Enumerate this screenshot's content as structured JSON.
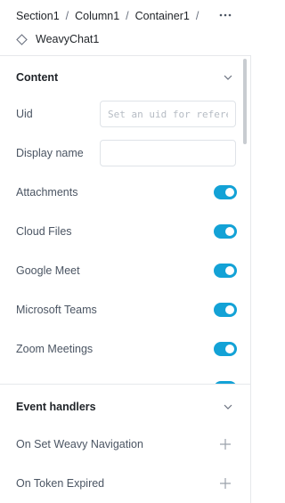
{
  "breadcrumb": {
    "items": [
      "Section1",
      "Column1",
      "Container1"
    ],
    "separator": "/"
  },
  "header": {
    "more_icon": "ellipsis-icon",
    "component_icon": "diamond-icon",
    "component_name": "WeavyChat1"
  },
  "content": {
    "title": "Content",
    "expanded": true,
    "uid": {
      "label": "Uid",
      "value": "",
      "placeholder": "Set an uid for reference"
    },
    "display_name": {
      "label": "Display name",
      "value": "",
      "placeholder": ""
    },
    "toggles": [
      {
        "label": "Attachments",
        "on": true
      },
      {
        "label": "Cloud Files",
        "on": true
      },
      {
        "label": "Google Meet",
        "on": true
      },
      {
        "label": "Microsoft Teams",
        "on": true
      },
      {
        "label": "Zoom Meetings",
        "on": true
      }
    ]
  },
  "event_handlers": {
    "title": "Event handlers",
    "items": [
      {
        "label": "On Set Weavy Navigation",
        "icon": "plus-icon"
      },
      {
        "label": "On Token Expired",
        "icon": "plus-icon"
      }
    ]
  },
  "colors": {
    "accent": "#13a2d6",
    "text": "#1f2328",
    "muted": "#4b5563",
    "border": "#e6e8eb"
  }
}
